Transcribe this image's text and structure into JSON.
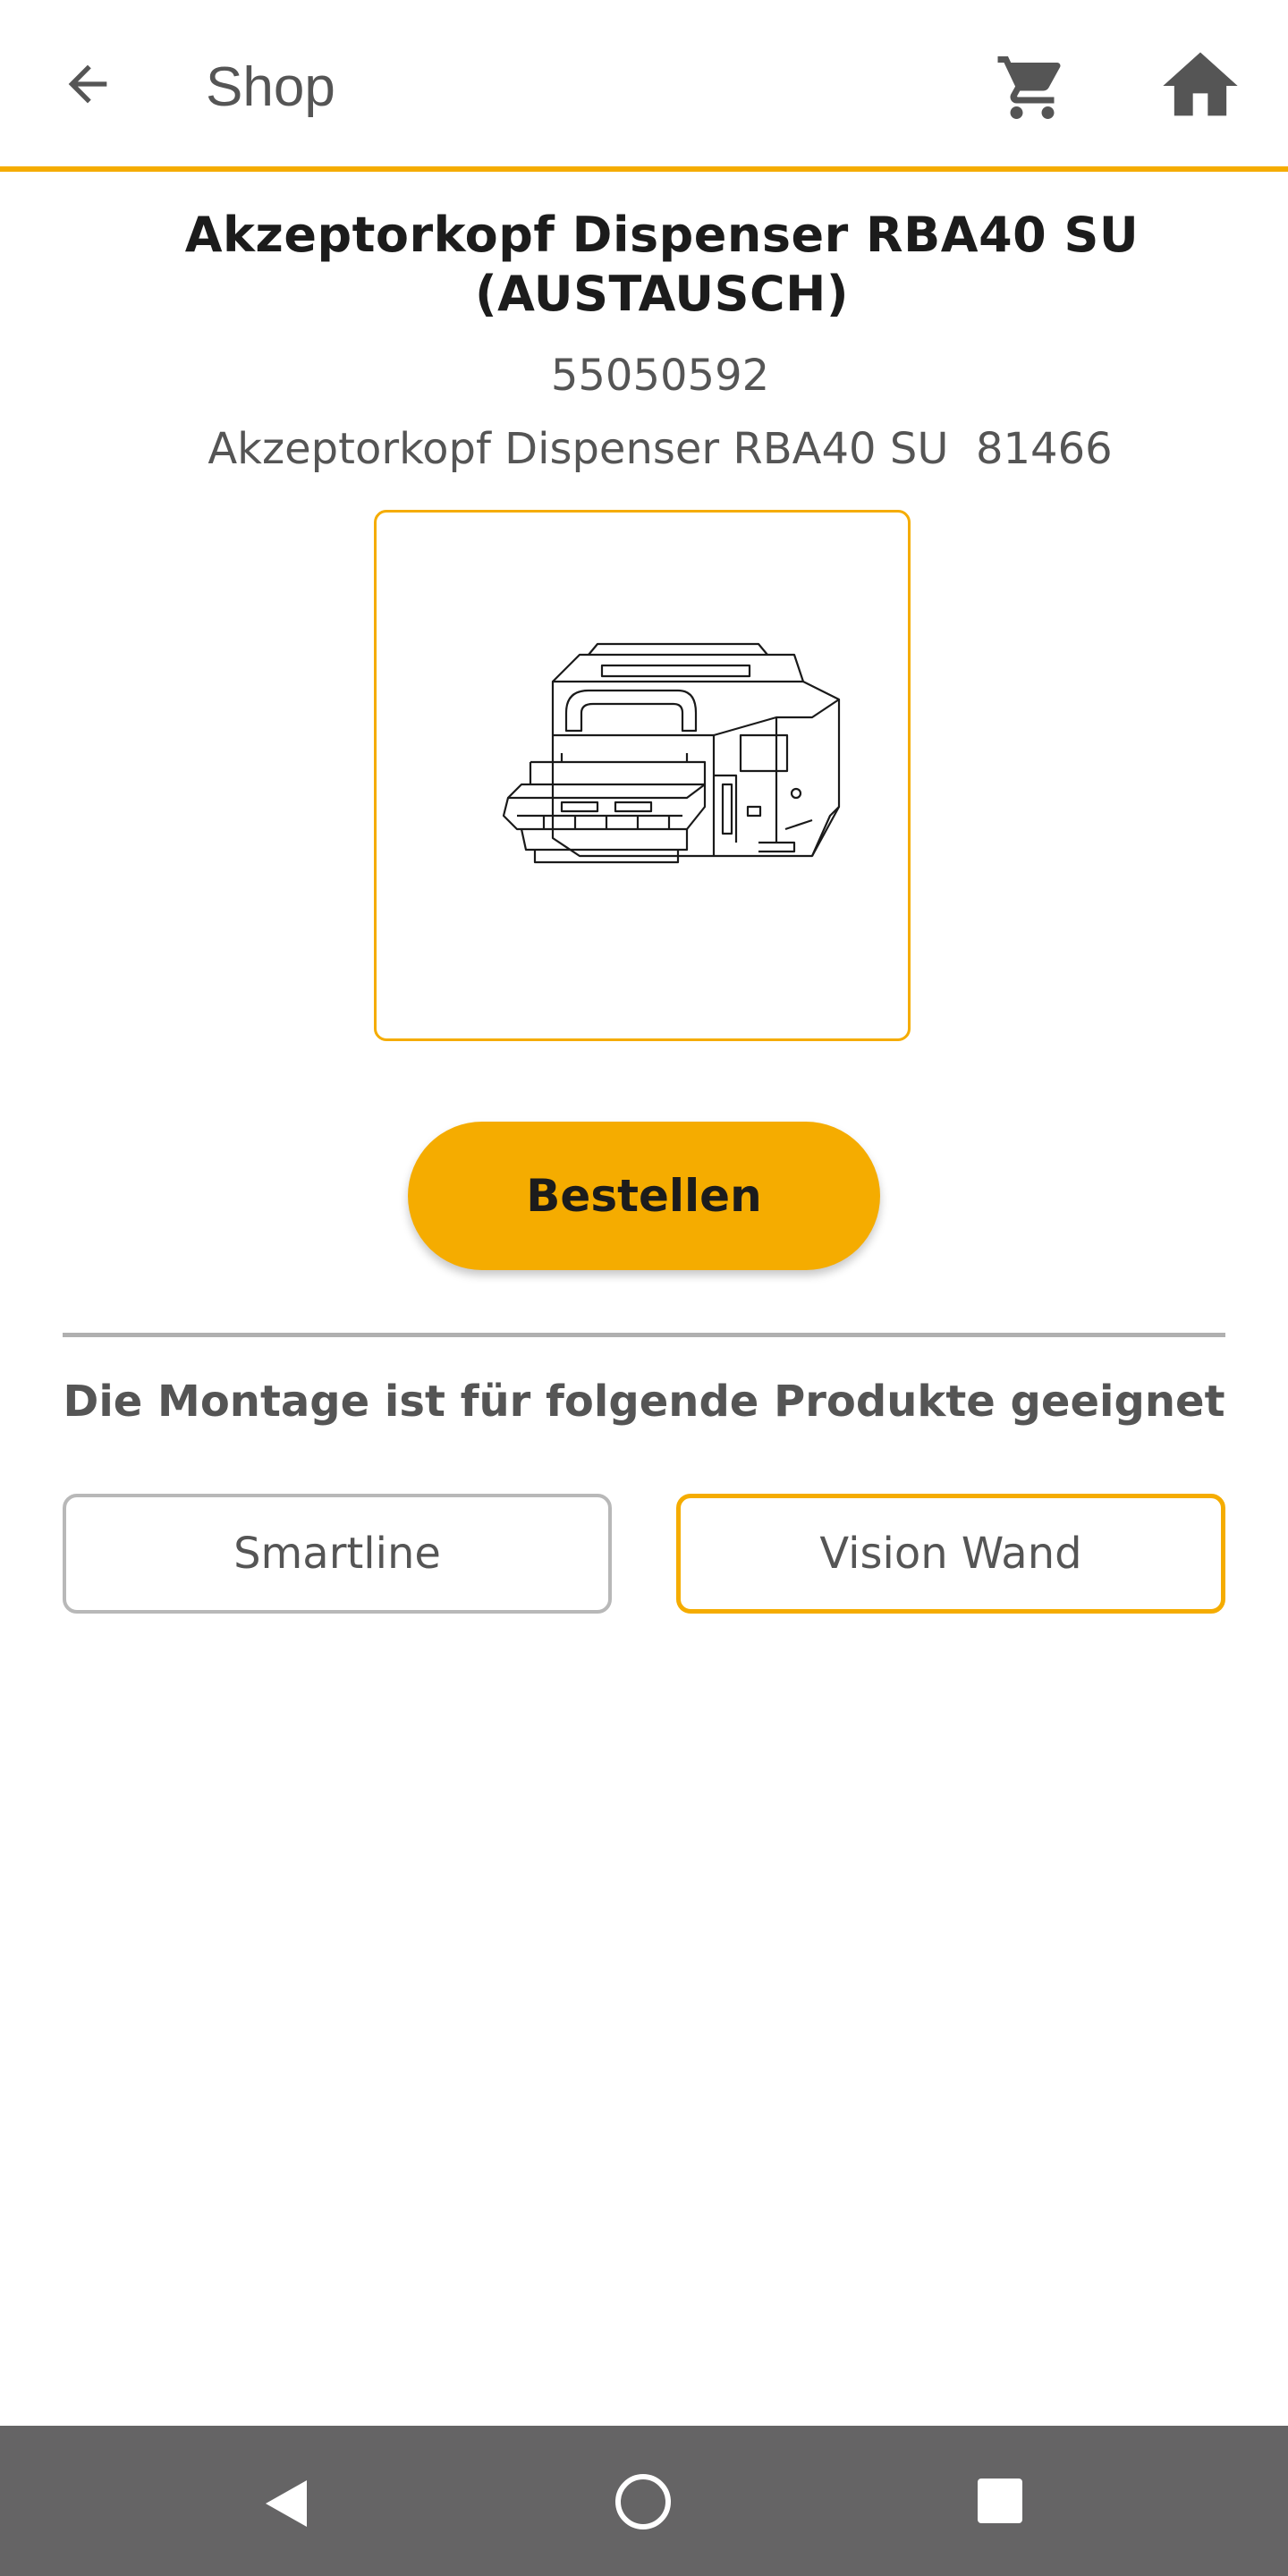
{
  "appbar": {
    "title": "Shop",
    "icons": {
      "back": "arrow-back-icon",
      "cart": "shopping-cart-icon",
      "home": "home-icon"
    }
  },
  "product": {
    "title": "Akzeptorkopf Dispenser RBA40 SU (AUSTAUSCH)",
    "number": "55050592",
    "description": "Akzeptorkopf Dispenser RBA40 SU  81466",
    "image": "dispenser-line-drawing"
  },
  "actions": {
    "order_label": "Bestellen"
  },
  "compatibility": {
    "heading": "Die Montage ist für folgende Produkte geeignet",
    "products": [
      {
        "label": "Smartline",
        "selected": false
      },
      {
        "label": "Vision Wand",
        "selected": true
      }
    ]
  },
  "system_nav": {
    "icons": [
      "nav-back-icon",
      "nav-home-icon",
      "nav-recents-icon"
    ]
  },
  "colors": {
    "accent": "#f5ac00",
    "text_dark": "#1c1c1c",
    "text_muted": "#555555",
    "nav_background": "#656465"
  }
}
